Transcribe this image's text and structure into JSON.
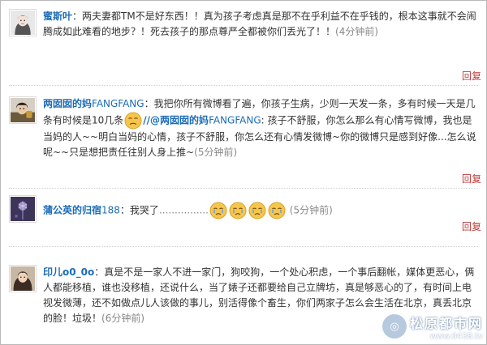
{
  "comments": [
    {
      "author": "蜜斯叶",
      "text": "：两夫妻都TM不是好东西！！真为孩子考虑真是那不在乎利益不在乎钱的，根本这事就不会闹腾成如此难看的地步？！死去孩子的那点尊严全都被你们丢光了！！",
      "time": "(4分钟前)",
      "reply_label": "回复",
      "avatar_icon": "avatar-icon"
    },
    {
      "author_main": "两囡囡的妈",
      "author_suffix": "FANGFANG",
      "text_a": "：我把你所有微博看了遍，你孩子生病，少则一天发一条，多有时候一天是几条有时候是10几条",
      "emoji_icon": "sad-face-emoji",
      "mention_prefix": "//@",
      "mention_main": "两囡囡的妈",
      "mention_suffix": "FANGFANG",
      "text_b": ": 孩子不舒服，你怎么那么有心情写微博，我也是当妈的人~~明白当妈的心情，孩子不舒服，你怎么还有心情发微博~你的微博只是感到好像...怎么说呢~~只是想把责任往别人身上推~",
      "time": "(5分钟前)",
      "reply_label": "回复",
      "avatar_icon": "avatar-icon"
    },
    {
      "author_main": "蒲公英的归宿",
      "author_suffix": "188",
      "text": "：我哭了",
      "dots": "................",
      "emoji_count": 4,
      "emoji_icon": "crying-face-emoji",
      "time": "(5分钟前)",
      "reply_label": "回复",
      "avatar_icon": "avatar-icon"
    },
    {
      "author": "印儿o0_0o",
      "text": "：真是不是一家人不进一家门，狗咬狗，一个处心积虑，一个事后翻帐，媒体更恶心，俩人都能移植，谁也没移植，还说什么，当了婊子还都要给自己立牌坊，真是够恶心的了，有时间上电视发微薄，还不如做点儿人该做的事儿，别活得像个畜生，你们两家子怎么会生活在北京，真丢北京的脸！垃圾！",
      "time": "(6分钟前)",
      "avatar_icon": "avatar-icon"
    }
  ],
  "watermark": {
    "name": "松原都市网",
    "url": "www.0438.tv",
    "logo_icon": "watermark-logo-icon"
  },
  "colors": {
    "username": "#1c6cb8",
    "reply": "#c03b3b",
    "text": "#333333",
    "muted": "#888888"
  }
}
